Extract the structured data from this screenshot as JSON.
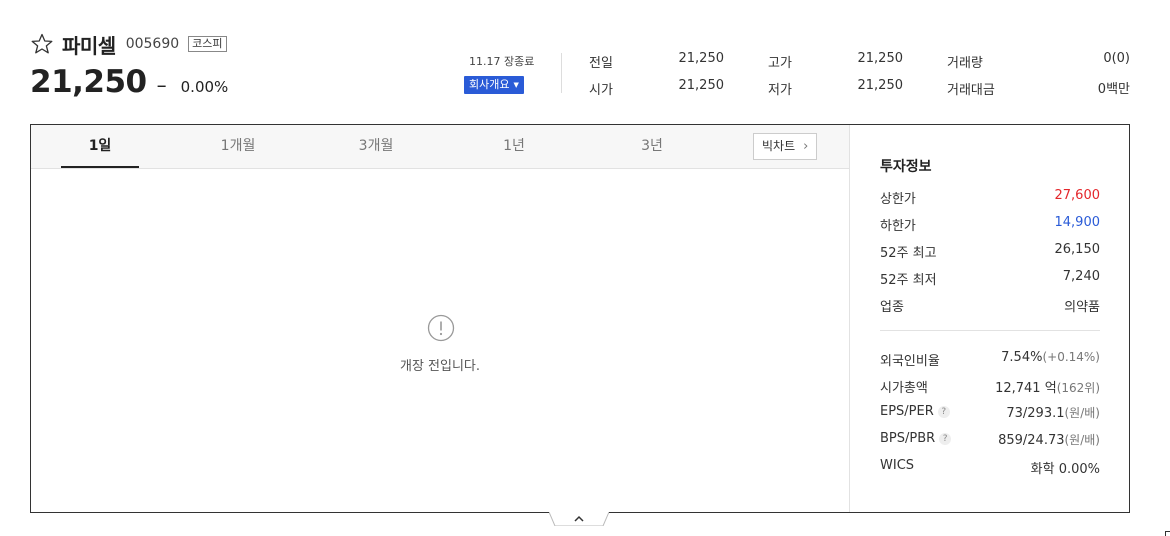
{
  "stock": {
    "name": "파미셀",
    "code": "005690",
    "market": "코스피",
    "price": "21,250",
    "change_symbol": "–",
    "change_pct": "0.00%"
  },
  "status": {
    "date_label": "11.17 장종료",
    "company_button": "회사개요",
    "caret": "▼"
  },
  "summary": [
    {
      "label": "전일",
      "value": "21,250"
    },
    {
      "label": "시가",
      "value": "21,250"
    },
    {
      "label": "고가",
      "value": "21,250"
    },
    {
      "label": "저가",
      "value": "21,250"
    },
    {
      "label": "거래량",
      "value": "0(0)"
    },
    {
      "label": "거래대금",
      "value": "0백만"
    }
  ],
  "chart": {
    "tabs": [
      "1일",
      "1개월",
      "3개월",
      "1년",
      "3년"
    ],
    "active_tab": "1일",
    "big_chart_label": "빅차트",
    "notice": "개장 전입니다."
  },
  "invest": {
    "title": "투자정보",
    "rows": [
      {
        "label": "상한가",
        "value": "27,600",
        "color": "#e4262b"
      },
      {
        "label": "하한가",
        "value": "14,900",
        "color": "#2a5bd7"
      },
      {
        "label": "52주 최고",
        "value": "26,150"
      },
      {
        "label": "52주 최저",
        "value": "7,240"
      },
      {
        "label": "업종",
        "value": "의약품"
      }
    ],
    "rows2": [
      {
        "label": "외국인비율",
        "value": "7.54%",
        "sub": "(+0.14%)"
      },
      {
        "label": "시가총액",
        "value": "12,741 억",
        "sub": "(162위)"
      },
      {
        "label": "EPS/PER",
        "value": "73/293.1",
        "sub": "(원/배)",
        "help": "?"
      },
      {
        "label": "BPS/PBR",
        "value": "859/24.73",
        "sub": "(원/배)",
        "help": "?"
      },
      {
        "label": "WICS",
        "value": "화학 0.00%"
      }
    ]
  }
}
